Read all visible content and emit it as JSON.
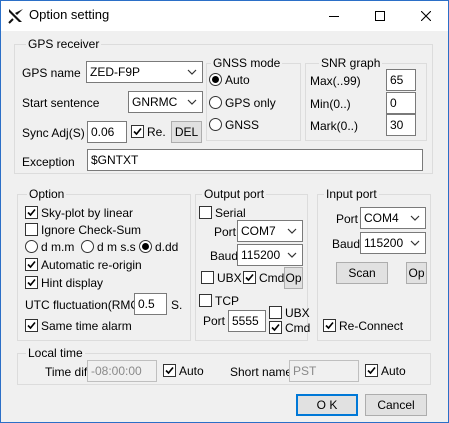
{
  "window": {
    "title": "Option setting",
    "icons": {
      "app": "app-logo-icon",
      "minimize": "minimize-icon",
      "maximize": "maximize-icon",
      "close": "close-icon"
    }
  },
  "gps_receiver": {
    "title": "GPS receiver",
    "gps_name_label": "GPS name",
    "gps_name_value": "ZED-F9P",
    "start_sentence_label": "Start sentence",
    "start_sentence_value": "GNRMC",
    "sync_label": "Sync Adj(S)",
    "sync_value": "0.06",
    "re_label": "Re.",
    "re_checked": true,
    "del_label": "DEL",
    "exception_label": "Exception",
    "exception_value": "$GNTXT"
  },
  "gnss_mode": {
    "title": "GNSS mode",
    "options": [
      "Auto",
      "GPS only",
      "GNSS"
    ],
    "selected": "Auto"
  },
  "snr_graph": {
    "title": "SNR graph",
    "max_label": "Max(..99)",
    "max_value": "65",
    "min_label": "Min(0..)",
    "min_value": "0",
    "mark_label": "Mark(0..)",
    "mark_value": "30"
  },
  "option": {
    "title": "Option",
    "sky_plot_label": "Sky-plot by linear",
    "sky_plot_checked": true,
    "ignore_checksum_label": "Ignore Check-Sum",
    "ignore_checksum_checked": false,
    "format_options": [
      "d m.m",
      "d m s.s",
      "d.dd"
    ],
    "format_selected": "d.dd",
    "auto_reorigin_label": "Automatic re-origin",
    "auto_reorigin_checked": true,
    "hint_display_label": "Hint display",
    "hint_display_checked": true,
    "utc_label": "UTC fluctuation(RMC)",
    "utc_value": "0.5",
    "utc_unit": "S.",
    "same_time_alarm_label": "Same time alarm",
    "same_time_alarm_checked": true
  },
  "output_port": {
    "title": "Output port",
    "serial_label": "Serial",
    "serial_checked": false,
    "port_label": "Port",
    "port_value": "COM7",
    "baud_label": "Baud",
    "baud_value": "115200",
    "ubx_label": "UBX",
    "ubx_checked": false,
    "cmd_label": "Cmd",
    "cmd_checked": true,
    "op_label": "Op",
    "tcp_label": "TCP",
    "tcp_checked": false,
    "tcp_port_label": "Port",
    "tcp_port_value": "5555",
    "tcp_ubx_label": "UBX",
    "tcp_ubx_checked": false,
    "tcp_cmd_label": "Cmd",
    "tcp_cmd_checked": true
  },
  "input_port": {
    "title": "Input port",
    "port_label": "Port",
    "port_value": "COM4",
    "baud_label": "Baud",
    "baud_value": "115200",
    "scan_label": "Scan",
    "op_label": "Op",
    "reconnect_label": "Re-Connect",
    "reconnect_checked": true
  },
  "local_time": {
    "title": "Local time",
    "time_diff_label": "Time diff",
    "time_diff_value": "-08:00:00",
    "auto1_label": "Auto",
    "auto1_checked": true,
    "short_name_label": "Short name",
    "short_name_value": "PST",
    "auto2_label": "Auto",
    "auto2_checked": true
  },
  "footer": {
    "ok_label": "O K",
    "cancel_label": "Cancel"
  },
  "colors": {
    "window_border": "#2b6fc7",
    "dialog_bg": "#f0f0f0",
    "default_button_border": "#0078d7"
  }
}
